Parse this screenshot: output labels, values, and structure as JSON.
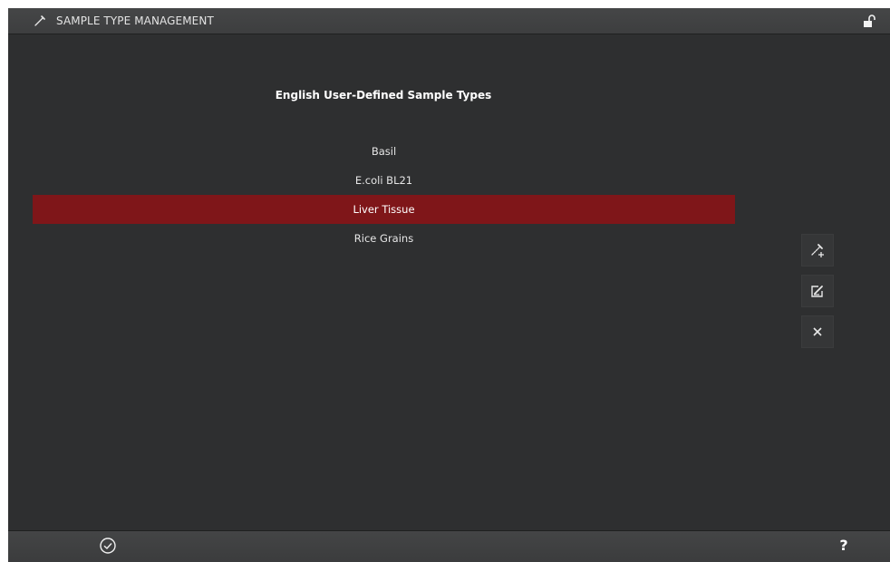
{
  "window": {
    "title": "SAMPLE TYPE MANAGEMENT",
    "title_icon": "pipette-icon",
    "lock_icon": "unlock-icon"
  },
  "list": {
    "title": "English User-Defined Sample Types",
    "selected_index": 2,
    "items": [
      "Basil",
      "E.coli BL21",
      "Liver Tissue",
      "Rice Grains"
    ]
  },
  "side_buttons": [
    {
      "name": "add-sample-type-button",
      "icon": "pipette-plus-icon"
    },
    {
      "name": "edit-sample-type-button",
      "icon": "edit-icon"
    },
    {
      "name": "delete-sample-type-button",
      "icon": "close-icon"
    }
  ],
  "bottom_bar": {
    "ok_icon": "check-circle-icon",
    "help_label": "?"
  },
  "colors": {
    "background": "#2e2f30",
    "selected_row": "#7f1619",
    "title_bar": "#424344"
  }
}
